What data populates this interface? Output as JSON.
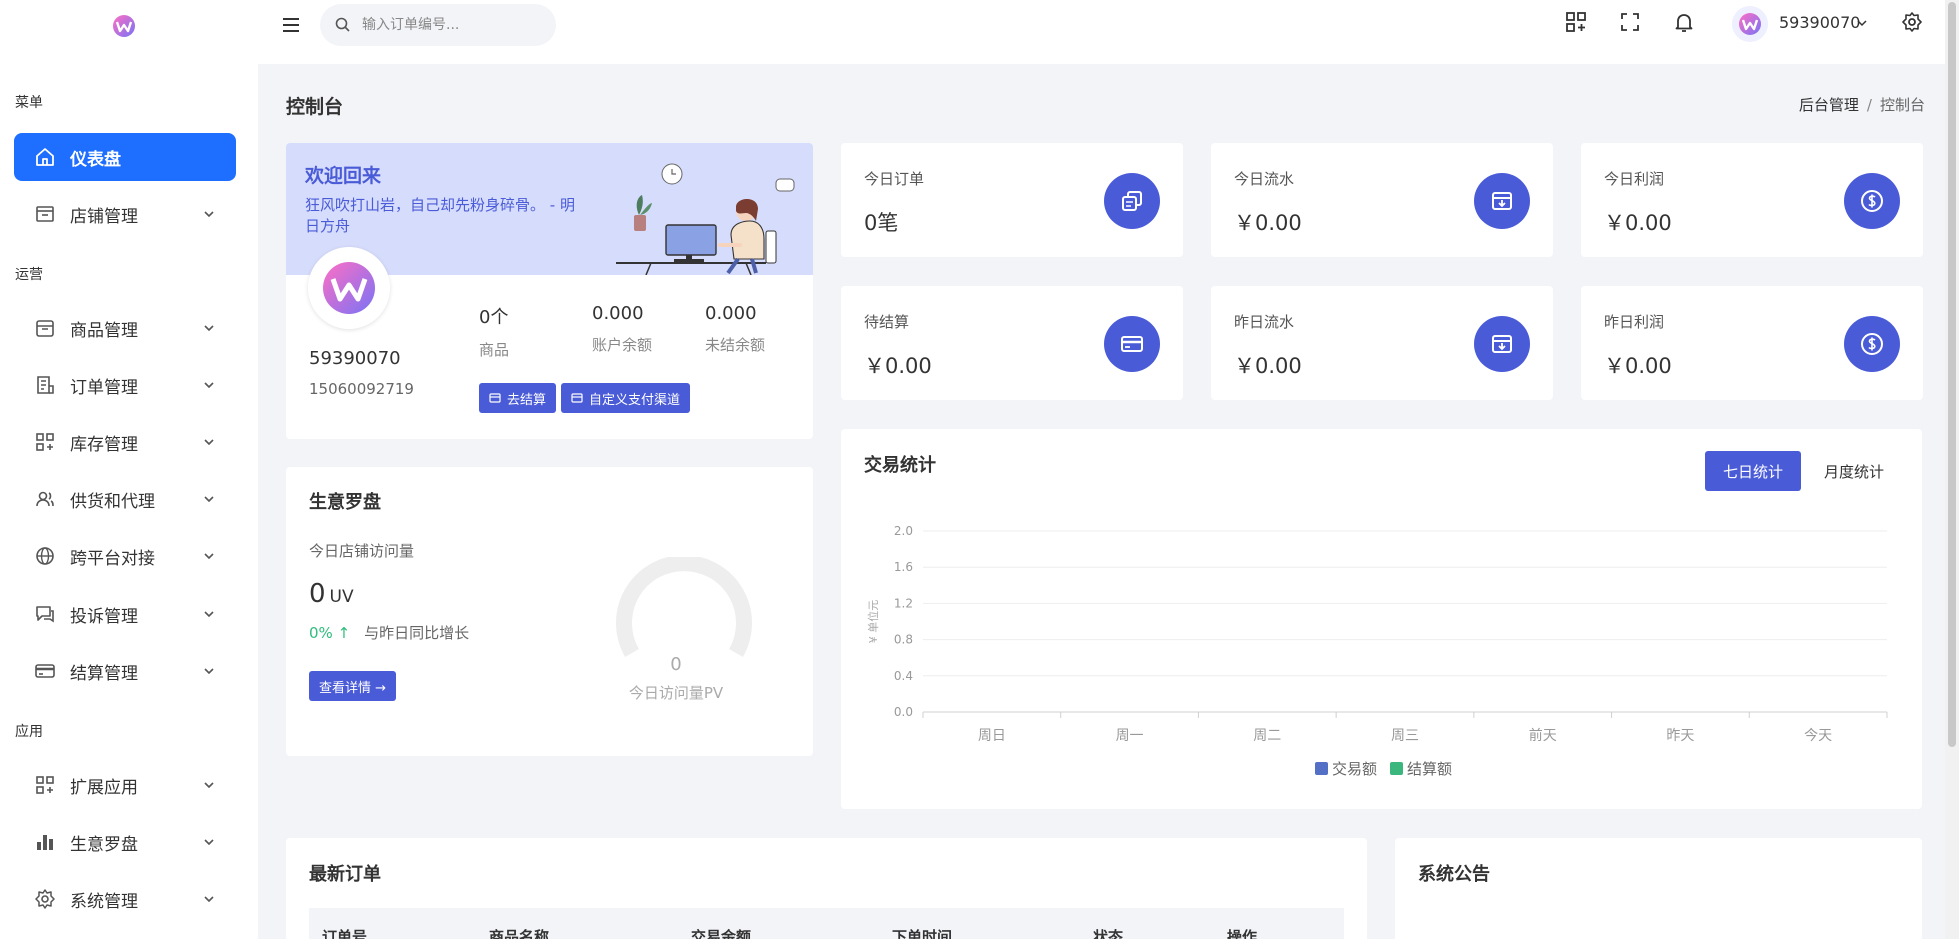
{
  "topbar": {
    "search_placeholder": "输入订单编号...",
    "username": "59390070",
    "icons": [
      "qr-code-icon",
      "fullscreen-icon",
      "bell-icon",
      "gear-icon"
    ]
  },
  "sidebar": {
    "sections": [
      {
        "label": "菜单",
        "items": [
          {
            "label": "仪表盘",
            "icon": "home-icon",
            "active": true
          },
          {
            "label": "店铺管理",
            "icon": "store-icon"
          }
        ]
      },
      {
        "label": "运营",
        "items": [
          {
            "label": "商品管理",
            "icon": "box-icon"
          },
          {
            "label": "订单管理",
            "icon": "order-icon"
          },
          {
            "label": "库存管理",
            "icon": "grid-plus-icon"
          },
          {
            "label": "供货和代理",
            "icon": "users-icon"
          },
          {
            "label": "跨平台对接",
            "icon": "globe-icon"
          },
          {
            "label": "投诉管理",
            "icon": "chat-icon"
          },
          {
            "label": "结算管理",
            "icon": "card-icon"
          }
        ]
      },
      {
        "label": "应用",
        "items": [
          {
            "label": "扩展应用",
            "icon": "apps-icon"
          },
          {
            "label": "生意罗盘",
            "icon": "bar-chart-icon"
          },
          {
            "label": "系统管理",
            "icon": "gear-icon"
          }
        ]
      }
    ]
  },
  "page": {
    "title": "控制台",
    "breadcrumb": [
      "后台管理",
      "控制台"
    ]
  },
  "welcome": {
    "title": "欢迎回来",
    "quote": "狂风吹打山岩，自己却先粉身碎骨。 - 明日方舟",
    "user_id": "59390070",
    "phone": "15060092719",
    "stats": [
      {
        "value": "0个",
        "label": "商品"
      },
      {
        "value": "0.000",
        "label": "账户余额"
      },
      {
        "value": "0.000",
        "label": "未结余额"
      }
    ],
    "buttons": [
      "去结算",
      "自定义支付渠道"
    ]
  },
  "kpis": [
    {
      "label": "今日订单",
      "value": "0笔",
      "icon": "copy-icon"
    },
    {
      "label": "今日流水",
      "value": "￥0.00",
      "icon": "inbox-download-icon"
    },
    {
      "label": "今日利润",
      "value": "￥0.00",
      "icon": "dollar-coin-icon"
    },
    {
      "label": "待结算",
      "value": "￥0.00",
      "icon": "credit-card-icon"
    },
    {
      "label": "昨日流水",
      "value": "￥0.00",
      "icon": "inbox-download-icon"
    },
    {
      "label": "昨日利润",
      "value": "￥0.00",
      "icon": "dollar-coin-icon"
    }
  ],
  "compass": {
    "title": "生意罗盘",
    "subtitle": "今日店铺访问量",
    "uv_value": "0",
    "uv_unit": "UV",
    "growth_pct": "0% ↑",
    "growth_label": "与昨日同比增长",
    "detail_button": "查看详情 →",
    "gauge_value": "0",
    "gauge_label": "今日访问量PV"
  },
  "chart_card": {
    "title": "交易统计",
    "tabs": [
      "七日统计",
      "月度统计"
    ],
    "active_tab": "七日统计"
  },
  "chart_data": {
    "type": "line",
    "categories": [
      "周日",
      "周一",
      "周二",
      "周三",
      "前天",
      "昨天",
      "今天"
    ],
    "series": [
      {
        "name": "交易额",
        "color": "#5470c6",
        "values": [
          0,
          0,
          0,
          0,
          0,
          0,
          0
        ]
      },
      {
        "name": "结算额",
        "color": "#3bb77e",
        "values": [
          0,
          0,
          0,
          0,
          0,
          0,
          0
        ]
      }
    ],
    "ylabel": "¥ 单位元",
    "ylim": [
      0,
      2.0
    ],
    "yticks": [
      "0.0",
      "0.4",
      "0.8",
      "1.2",
      "1.6",
      "2.0"
    ],
    "grid": true,
    "legend": "bottom-center"
  },
  "orders": {
    "title": "最新订单",
    "columns": [
      "订单号",
      "商品名称",
      "交易金额",
      "下单时间",
      "状态",
      "操作"
    ]
  },
  "notice": {
    "title": "系统公告"
  }
}
